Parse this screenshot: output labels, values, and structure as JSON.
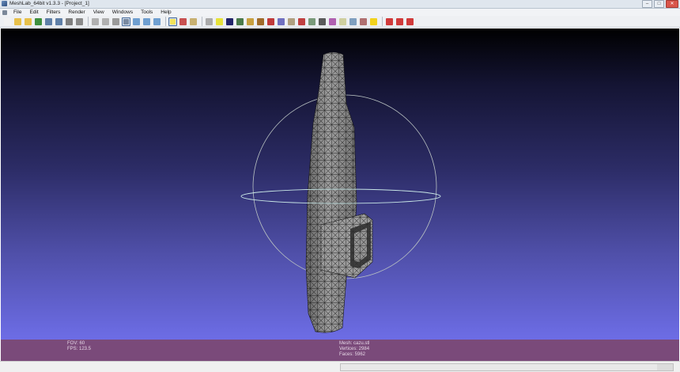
{
  "window": {
    "title": "MeshLab_64bit v1.3.3 - [Project_1]",
    "minimize_label": "–",
    "maximize_label": "□",
    "close_label": "✕"
  },
  "menu": {
    "items": [
      "File",
      "Edit",
      "Filters",
      "Render",
      "View",
      "Windows",
      "Tools",
      "Help"
    ]
  },
  "toolbar": {
    "buttons": [
      {
        "name": "new-icon",
        "color": "#f2f2f2",
        "active": false
      },
      {
        "name": "open-icon",
        "color": "#e7c04a",
        "active": false
      },
      {
        "name": "open-recent-icon",
        "color": "#e7c04a",
        "active": false
      },
      {
        "name": "reload-icon",
        "color": "#3e8f3e",
        "active": false
      },
      {
        "name": "import-mesh-icon",
        "color": "#5f7fa7",
        "active": false
      },
      {
        "name": "export-mesh-icon",
        "color": "#5f7fa7",
        "active": false
      },
      {
        "name": "save-snapshot-icon",
        "color": "#7f7f7f",
        "active": false
      },
      {
        "name": "print-icon",
        "color": "#8a8a8a",
        "active": false
      },
      {
        "name": "sep"
      },
      {
        "name": "bounding-box-icon",
        "color": "#b0b0b0",
        "active": false
      },
      {
        "name": "points-icon",
        "color": "#b0b0b0",
        "active": false
      },
      {
        "name": "wireframe-icon",
        "color": "#9a9a9a",
        "active": false
      },
      {
        "name": "hidden-lines-icon",
        "color": "#7a8aa0",
        "active": true
      },
      {
        "name": "flat-lines-icon",
        "color": "#6f9fd0",
        "active": false
      },
      {
        "name": "flat-icon",
        "color": "#6f9fd0",
        "active": false
      },
      {
        "name": "smooth-icon",
        "color": "#6f9fd0",
        "active": false
      },
      {
        "name": "sep"
      },
      {
        "name": "light-on-icon",
        "color": "#f2e35a",
        "active": true
      },
      {
        "name": "double-side-light-icon",
        "color": "#c85050",
        "active": false
      },
      {
        "name": "fancy-lighting-icon",
        "color": "#c8b070",
        "active": false
      },
      {
        "name": "sep"
      },
      {
        "name": "color-per-vertex-icon",
        "color": "#aaaaaa",
        "active": false
      },
      {
        "name": "measure-icon",
        "color": "#e6e23a",
        "active": false
      },
      {
        "name": "render-quality-icon",
        "color": "#22246a",
        "active": false
      },
      {
        "name": "show-layers-icon",
        "color": "#4a7a4a",
        "active": false
      },
      {
        "name": "paint-icon",
        "color": "#c8a040",
        "active": false
      },
      {
        "name": "draw-icon",
        "color": "#a06b2a",
        "active": false
      },
      {
        "name": "select-faces-icon",
        "color": "#c03a3a",
        "active": false
      },
      {
        "name": "select-vertexes-icon",
        "color": "#7070c0",
        "active": false
      },
      {
        "name": "transform-icon",
        "color": "#b0a080",
        "active": false
      },
      {
        "name": "align-icon",
        "color": "#c04040",
        "active": false
      },
      {
        "name": "pick-points-icon",
        "color": "#7a9a7a",
        "active": false
      },
      {
        "name": "manipulator-icon",
        "color": "#5a5a5a",
        "active": false
      },
      {
        "name": "raster-align-icon",
        "color": "#b060b0",
        "active": false
      },
      {
        "name": "quality-mapper-icon",
        "color": "#cfcf9f",
        "active": false
      },
      {
        "name": "select-connected-icon",
        "color": "#7f9fbf",
        "active": false
      },
      {
        "name": "fill-hole-icon",
        "color": "#b07070",
        "active": false
      },
      {
        "name": "info-icon",
        "color": "#f2d21c",
        "active": false
      },
      {
        "name": "sep"
      },
      {
        "name": "delete-faces-icon",
        "color": "#d03a3a",
        "active": false
      },
      {
        "name": "delete-vertices-icon",
        "color": "#d03a3a",
        "active": false
      },
      {
        "name": "delete-selection-icon",
        "color": "#d03a3a",
        "active": false
      }
    ]
  },
  "viewport": {
    "gradient_top": "#000000",
    "gradient_bottom": "#6d6de6",
    "trackball_color": "#b9c2c2"
  },
  "status": {
    "fov": "FOV: 60",
    "fps": "FPS:   123.5",
    "mesh": "Mesh: cazu.stl",
    "vertices": "Vertices: 2984",
    "faces": "Faces: 5962"
  }
}
